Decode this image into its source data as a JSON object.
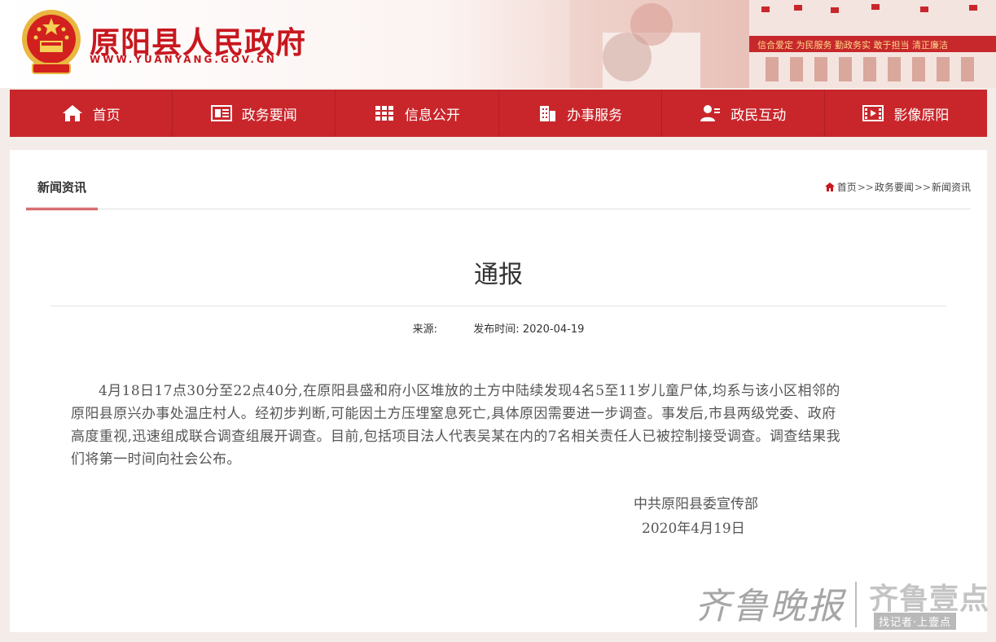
{
  "header": {
    "site_title": "原阳县人民政府",
    "domain": "WWW.YUANYANG.GOV.CN",
    "banner_slogans": "信合爱定  为民服务  勤政务实  敢于担当  清正廉洁"
  },
  "nav": {
    "items": [
      {
        "label": "首页",
        "icon": "home-icon"
      },
      {
        "label": "政务要闻",
        "icon": "newspaper-icon"
      },
      {
        "label": "信息公开",
        "icon": "books-icon"
      },
      {
        "label": "办事服务",
        "icon": "building-icon"
      },
      {
        "label": "政民互动",
        "icon": "user-chat-icon"
      },
      {
        "label": "影像原阳",
        "icon": "film-icon"
      }
    ]
  },
  "section": {
    "tab_label": "新闻资讯"
  },
  "breadcrumb": {
    "home": "首页",
    "sep": ">>",
    "level1": "政务要闻",
    "level2": "新闻资讯"
  },
  "article": {
    "title": "通报",
    "source_label": "来源:",
    "date_label": "发布时间:",
    "date": "2020-04-19",
    "body": "4月18日17点30分至22点40分,在原阳县盛和府小区堆放的土方中陆续发现4名5至11岁儿童尸体,均系与该小区相邻的原阳县原兴办事处温庄村人。经初步判断,可能因土方压埋窒息死亡,具体原因需要进一步调查。事发后,市县两级党委、政府高度重视,迅速组成联合调查组展开调查。目前,包括项目法人代表吴某在内的7名相关责任人已被控制接受调查。调查结果我们将第一时间向社会公布。",
    "sign_org": "中共原阳县委宣传部",
    "sign_date": "2020年4月19日"
  },
  "watermark": {
    "left": "齐鲁晚报",
    "right": "齐鲁壹点",
    "tag": "找记者·上壹点"
  },
  "colors": {
    "brand_red": "#c9262b",
    "text_gray": "#555555"
  }
}
